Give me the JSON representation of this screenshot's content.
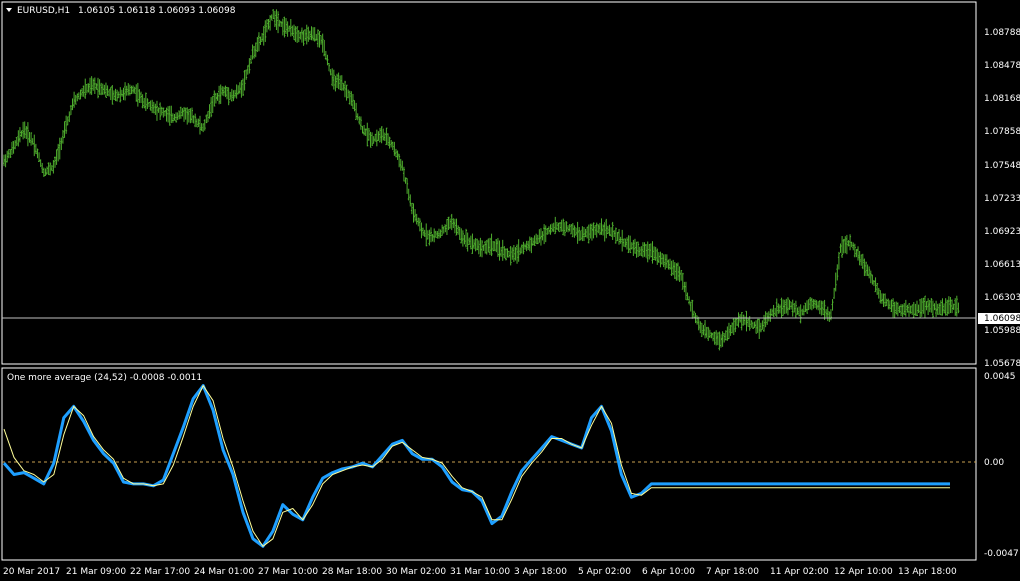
{
  "main_window": {
    "symbol_label": "EURUSD,H1",
    "ohlc": "1.06105 1.06118 1.06093 1.06098",
    "price_axis": [
      "1.08788",
      "1.08478",
      "1.08168",
      "1.07858",
      "1.07548",
      "1.07233",
      "1.06923",
      "1.06613",
      "1.06303",
      "1.05988",
      "1.05678"
    ],
    "current_price": "1.06098"
  },
  "indicator_window": {
    "label": "One more average (24,52) -0.0008 -0.0011",
    "axis": [
      "0.0045",
      "0.00",
      "-0.0047"
    ]
  },
  "time_axis": [
    "20 Mar 2017",
    "21 Mar 09:00",
    "22 Mar 17:00",
    "24 Mar 01:00",
    "27 Mar 10:00",
    "28 Mar 18:00",
    "30 Mar 02:00",
    "31 Mar 10:00",
    "3 Apr 18:00",
    "5 Apr 02:00",
    "6 Apr 10:00",
    "7 Apr 18:00",
    "11 Apr 02:00",
    "12 Apr 10:00",
    "13 Apr 18:00"
  ],
  "colors": {
    "background": "#000000",
    "bars": "#4fae2e",
    "axis": "#ffffff",
    "price_line": "#c0c0c0",
    "indicator_fast": "#1e9fff",
    "indicator_slow": "#ffff99",
    "zero_line": "#c8a050"
  },
  "chart_data": [
    {
      "type": "line",
      "title": "EURUSD,H1",
      "ylim": [
        1.056,
        1.089
      ],
      "x": [
        0,
        10,
        20,
        30,
        40,
        50,
        60,
        70,
        80,
        90,
        100,
        110,
        120,
        130,
        140,
        150,
        160,
        170,
        180,
        190,
        200,
        210,
        220,
        230,
        240,
        250,
        260,
        270,
        280,
        290,
        300,
        310,
        320,
        330,
        340,
        350,
        360,
        370,
        380,
        390,
        400,
        410,
        420,
        430,
        440,
        450,
        460,
        470,
        480,
        490,
        500,
        510,
        520,
        530,
        540,
        550,
        560,
        570,
        580,
        590,
        600,
        610,
        620,
        630,
        640,
        650,
        660,
        670,
        680,
        690,
        700,
        710,
        720,
        730,
        740,
        750,
        760,
        770,
        780,
        790,
        800,
        810,
        820,
        830,
        840,
        850,
        860,
        870,
        880,
        890,
        900,
        910,
        920,
        930,
        940,
        950,
        960
      ],
      "y": [
        1.0745,
        1.0758,
        1.0775,
        1.0762,
        1.0735,
        1.074,
        1.077,
        1.08,
        1.081,
        1.0815,
        1.0812,
        1.0805,
        1.0808,
        1.0812,
        1.08,
        1.0795,
        1.079,
        1.0785,
        1.079,
        1.0785,
        1.0775,
        1.08,
        1.081,
        1.0805,
        1.0815,
        1.0845,
        1.086,
        1.088,
        1.087,
        1.0865,
        1.086,
        1.0862,
        1.0855,
        1.082,
        1.0815,
        1.08,
        1.0775,
        1.0765,
        1.077,
        1.076,
        1.074,
        1.07,
        1.068,
        1.0675,
        1.068,
        1.069,
        1.0675,
        1.067,
        1.0665,
        1.0668,
        1.0662,
        1.0658,
        1.0664,
        1.067,
        1.0676,
        1.0684,
        1.0685,
        1.0682,
        1.0677,
        1.068,
        1.0684,
        1.068,
        1.0672,
        1.0667,
        1.0662,
        1.0663,
        1.0655,
        1.0648,
        1.064,
        1.061,
        1.059,
        1.0585,
        1.058,
        1.059,
        1.06,
        1.0595,
        1.0592,
        1.0605,
        1.061,
        1.0612,
        1.0605,
        1.0615,
        1.0612,
        1.06,
        1.0665,
        1.067,
        1.0655,
        1.064,
        1.062,
        1.0612,
        1.0608,
        1.0608,
        1.061,
        1.0612,
        1.0608,
        1.0612,
        1.061
      ]
    },
    {
      "type": "line",
      "title": "One more average (24,52)",
      "ylim": [
        -0.0047,
        0.0045
      ],
      "x": [
        0,
        10,
        20,
        30,
        40,
        50,
        60,
        70,
        80,
        90,
        100,
        110,
        120,
        130,
        140,
        150,
        160,
        170,
        180,
        190,
        200,
        210,
        220,
        230,
        240,
        250,
        260,
        270,
        280,
        290,
        300,
        310,
        320,
        330,
        340,
        350,
        360,
        370,
        380,
        390,
        400,
        410,
        420,
        430,
        440,
        450,
        460,
        470,
        480,
        490,
        500,
        510,
        520,
        530,
        540,
        550,
        560,
        570,
        580,
        590,
        600,
        610,
        620,
        630,
        640,
        650,
        660,
        670,
        680,
        690,
        700,
        710,
        720,
        730,
        740,
        750,
        760,
        770,
        780,
        790,
        800,
        810,
        820,
        830,
        840,
        850,
        860,
        870,
        880,
        890,
        900,
        910,
        920,
        930,
        940,
        950,
        960
      ],
      "series": [
        {
          "values": [
            0.0,
            -0.0006,
            -0.0005,
            -0.0008,
            -0.0011,
            0.0,
            0.0024,
            0.003,
            0.0022,
            0.0012,
            0.0005,
            0.0,
            -0.001,
            -0.0011,
            -0.0011,
            -0.0012,
            -0.0009,
            0.0005,
            0.0019,
            0.0034,
            0.0041,
            0.0028,
            0.0007,
            -0.0006,
            -0.0026,
            -0.004,
            -0.0044,
            -0.0036,
            -0.0022,
            -0.0027,
            -0.003,
            -0.0018,
            -0.0008,
            -0.0005,
            -0.0003,
            -0.0002,
            0.0,
            -0.0002,
            0.0004,
            0.001,
            0.0012,
            0.0005,
            0.0002,
            0.0002,
            -0.0002,
            -0.001,
            -0.0014,
            -0.0015,
            -0.002,
            -0.0032,
            -0.0028,
            -0.0015,
            -0.0004,
            0.0002,
            0.0008,
            0.0014,
            0.0012,
            0.001,
            0.0008,
            0.0024,
            0.003,
            0.0017,
            -0.0006,
            -0.0018,
            -0.0016,
            -0.0011,
            -0.0011,
            -0.0011,
            -0.0011,
            -0.0011,
            -0.0011,
            -0.0011,
            -0.0011,
            -0.0011,
            -0.0011,
            -0.0011,
            -0.0011,
            -0.0011,
            -0.0011,
            -0.0011,
            -0.0011,
            -0.0011,
            -0.0011,
            -0.0011,
            -0.0011,
            -0.0011,
            -0.0011,
            -0.0011,
            -0.0011,
            -0.0011,
            -0.0011,
            -0.0011,
            -0.0011,
            -0.0011,
            -0.0011,
            -0.0011,
            -0.0011
          ]
        },
        {
          "values": [
            0.0018,
            0.0003,
            -0.0004,
            -0.0006,
            -0.001,
            -0.0006,
            0.0015,
            0.003,
            0.0025,
            0.0014,
            0.0007,
            0.0002,
            -0.0008,
            -0.0011,
            -0.0011,
            -0.0012,
            -0.0011,
            -0.0001,
            0.0014,
            0.003,
            0.0041,
            0.0033,
            0.0013,
            -0.0002,
            -0.002,
            -0.0036,
            -0.0044,
            -0.004,
            -0.0026,
            -0.0024,
            -0.003,
            -0.0022,
            -0.0011,
            -0.0006,
            -0.0004,
            -0.0002,
            -0.0001,
            -0.0002,
            0.0002,
            0.0009,
            0.0011,
            0.0007,
            0.0003,
            0.0002,
            0.0,
            -0.0007,
            -0.0013,
            -0.0015,
            -0.0018,
            -0.003,
            -0.003,
            -0.0019,
            -0.0007,
            0.0,
            0.0006,
            0.0013,
            0.0013,
            0.001,
            0.0008,
            0.002,
            0.003,
            0.0021,
            -0.0001,
            -0.0016,
            -0.0017,
            -0.0013,
            -0.0013,
            -0.0013,
            -0.0013,
            -0.0013,
            -0.0013,
            -0.0013,
            -0.0013,
            -0.0013,
            -0.0013,
            -0.0013,
            -0.0013,
            -0.0013,
            -0.0013,
            -0.0013,
            -0.0013,
            -0.0013,
            -0.0013,
            -0.0013,
            -0.0013,
            -0.0013,
            -0.0013,
            -0.0013,
            -0.0013,
            -0.0013,
            -0.0013,
            -0.0013,
            -0.0013,
            -0.0013,
            -0.0013,
            -0.0013,
            -0.0013
          ]
        }
      ]
    }
  ]
}
